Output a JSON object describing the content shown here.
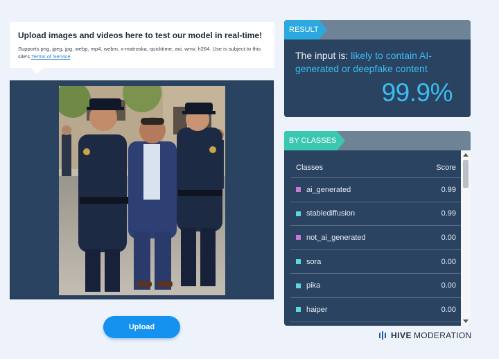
{
  "info": {
    "title": "Upload images and videos here to test our model in real-time!",
    "subtitle_prefix": "Supports png, jpeg, jpg, webp, mp4, webm, x-matroska, quicktime, avi, wmv, h264. Use is subject to this site's ",
    "terms_link": "Terms of Service",
    "subtitle_suffix": "."
  },
  "image_panel": {
    "alt": "Uploaded photo: a man in a suit escorted by uniformed police officers on a city street"
  },
  "upload": {
    "label": "Upload"
  },
  "result": {
    "tag": "RESULT",
    "prefix": "The input is: ",
    "verdict": "likely to contain AI-generated or deepfake content",
    "score": "99.9%",
    "accent": "#3bbcf3"
  },
  "classes": {
    "tag": "BY CLASSES",
    "col_class": "Classes",
    "col_score": "Score",
    "rows": [
      {
        "name": "ai_generated",
        "score": "0.99",
        "color": "#c97ad8"
      },
      {
        "name": "stablediffusion",
        "score": "0.99",
        "color": "#5fd6e6"
      },
      {
        "name": "not_ai_generated",
        "score": "0.00",
        "color": "#c97ad8"
      },
      {
        "name": "sora",
        "score": "0.00",
        "color": "#5fd6e6"
      },
      {
        "name": "pika",
        "score": "0.00",
        "color": "#5fd6e6"
      },
      {
        "name": "haiper",
        "score": "0.00",
        "color": "#5fd6e6"
      }
    ]
  },
  "brand": {
    "hive": "HIVE",
    "moderation": "MODERATION",
    "icon": "hive-bars-icon"
  }
}
